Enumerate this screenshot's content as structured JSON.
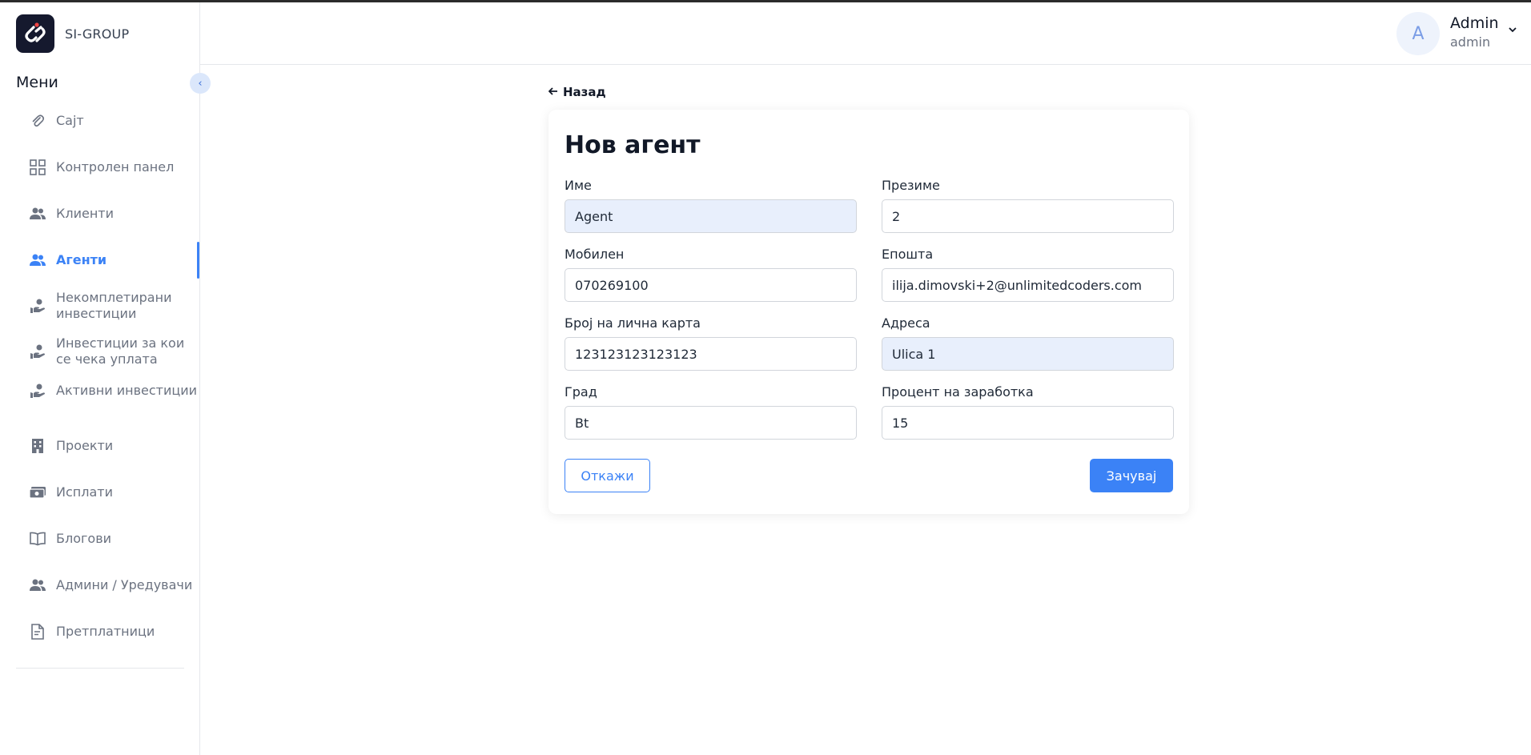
{
  "brand": {
    "name": "SI-GROUP"
  },
  "sidebar": {
    "title": "Мени",
    "collapse_glyph": "‹",
    "items": [
      {
        "label": "Сајт",
        "icon": "paperclip-icon"
      },
      {
        "label": "Контролен панел",
        "icon": "dashboard-grid-icon"
      },
      {
        "label": "Клиенти",
        "icon": "users-icon"
      },
      {
        "label": "Агенти",
        "icon": "users-icon",
        "active": true
      },
      {
        "label": "Некомплетирани инвестиции",
        "icon": "hand-coin-icon"
      },
      {
        "label": "Инвестиции за кои се чека уплата",
        "icon": "hand-coin-icon"
      },
      {
        "label": "Активни инвестиции",
        "icon": "hand-coin-icon"
      },
      {
        "label": "Проекти",
        "icon": "building-icon"
      },
      {
        "label": "Исплати",
        "icon": "money-icon"
      },
      {
        "label": "Блогови",
        "icon": "book-icon"
      },
      {
        "label": "Админи / Уредувачи",
        "icon": "users-icon"
      },
      {
        "label": "Претплатници",
        "icon": "document-icon"
      }
    ]
  },
  "header": {
    "avatar_initial": "A",
    "user_name": "Admin",
    "user_role": "admin"
  },
  "page": {
    "back_label": "Назад",
    "title": "Нов агент"
  },
  "form": {
    "first_name": {
      "label": "Име",
      "value": "Agent"
    },
    "last_name": {
      "label": "Презиме",
      "value": "2"
    },
    "mobile": {
      "label": "Мобилен",
      "value": "070269100"
    },
    "email": {
      "label": "Епошта",
      "value": "ilija.dimovski+2@unlimitedcoders.com"
    },
    "id_card": {
      "label": "Број на лична карта",
      "value": "123123123123123"
    },
    "address": {
      "label": "Адреса",
      "value": "Ulica 1"
    },
    "city": {
      "label": "Град",
      "value": "Bt"
    },
    "commission": {
      "label": "Процент на заработка",
      "value": "15"
    },
    "cancel_label": "Откажи",
    "save_label": "Зачувај"
  },
  "colors": {
    "accent": "#3b82f6",
    "brand_bg": "#15192e",
    "filled_input": "#e8effc"
  }
}
